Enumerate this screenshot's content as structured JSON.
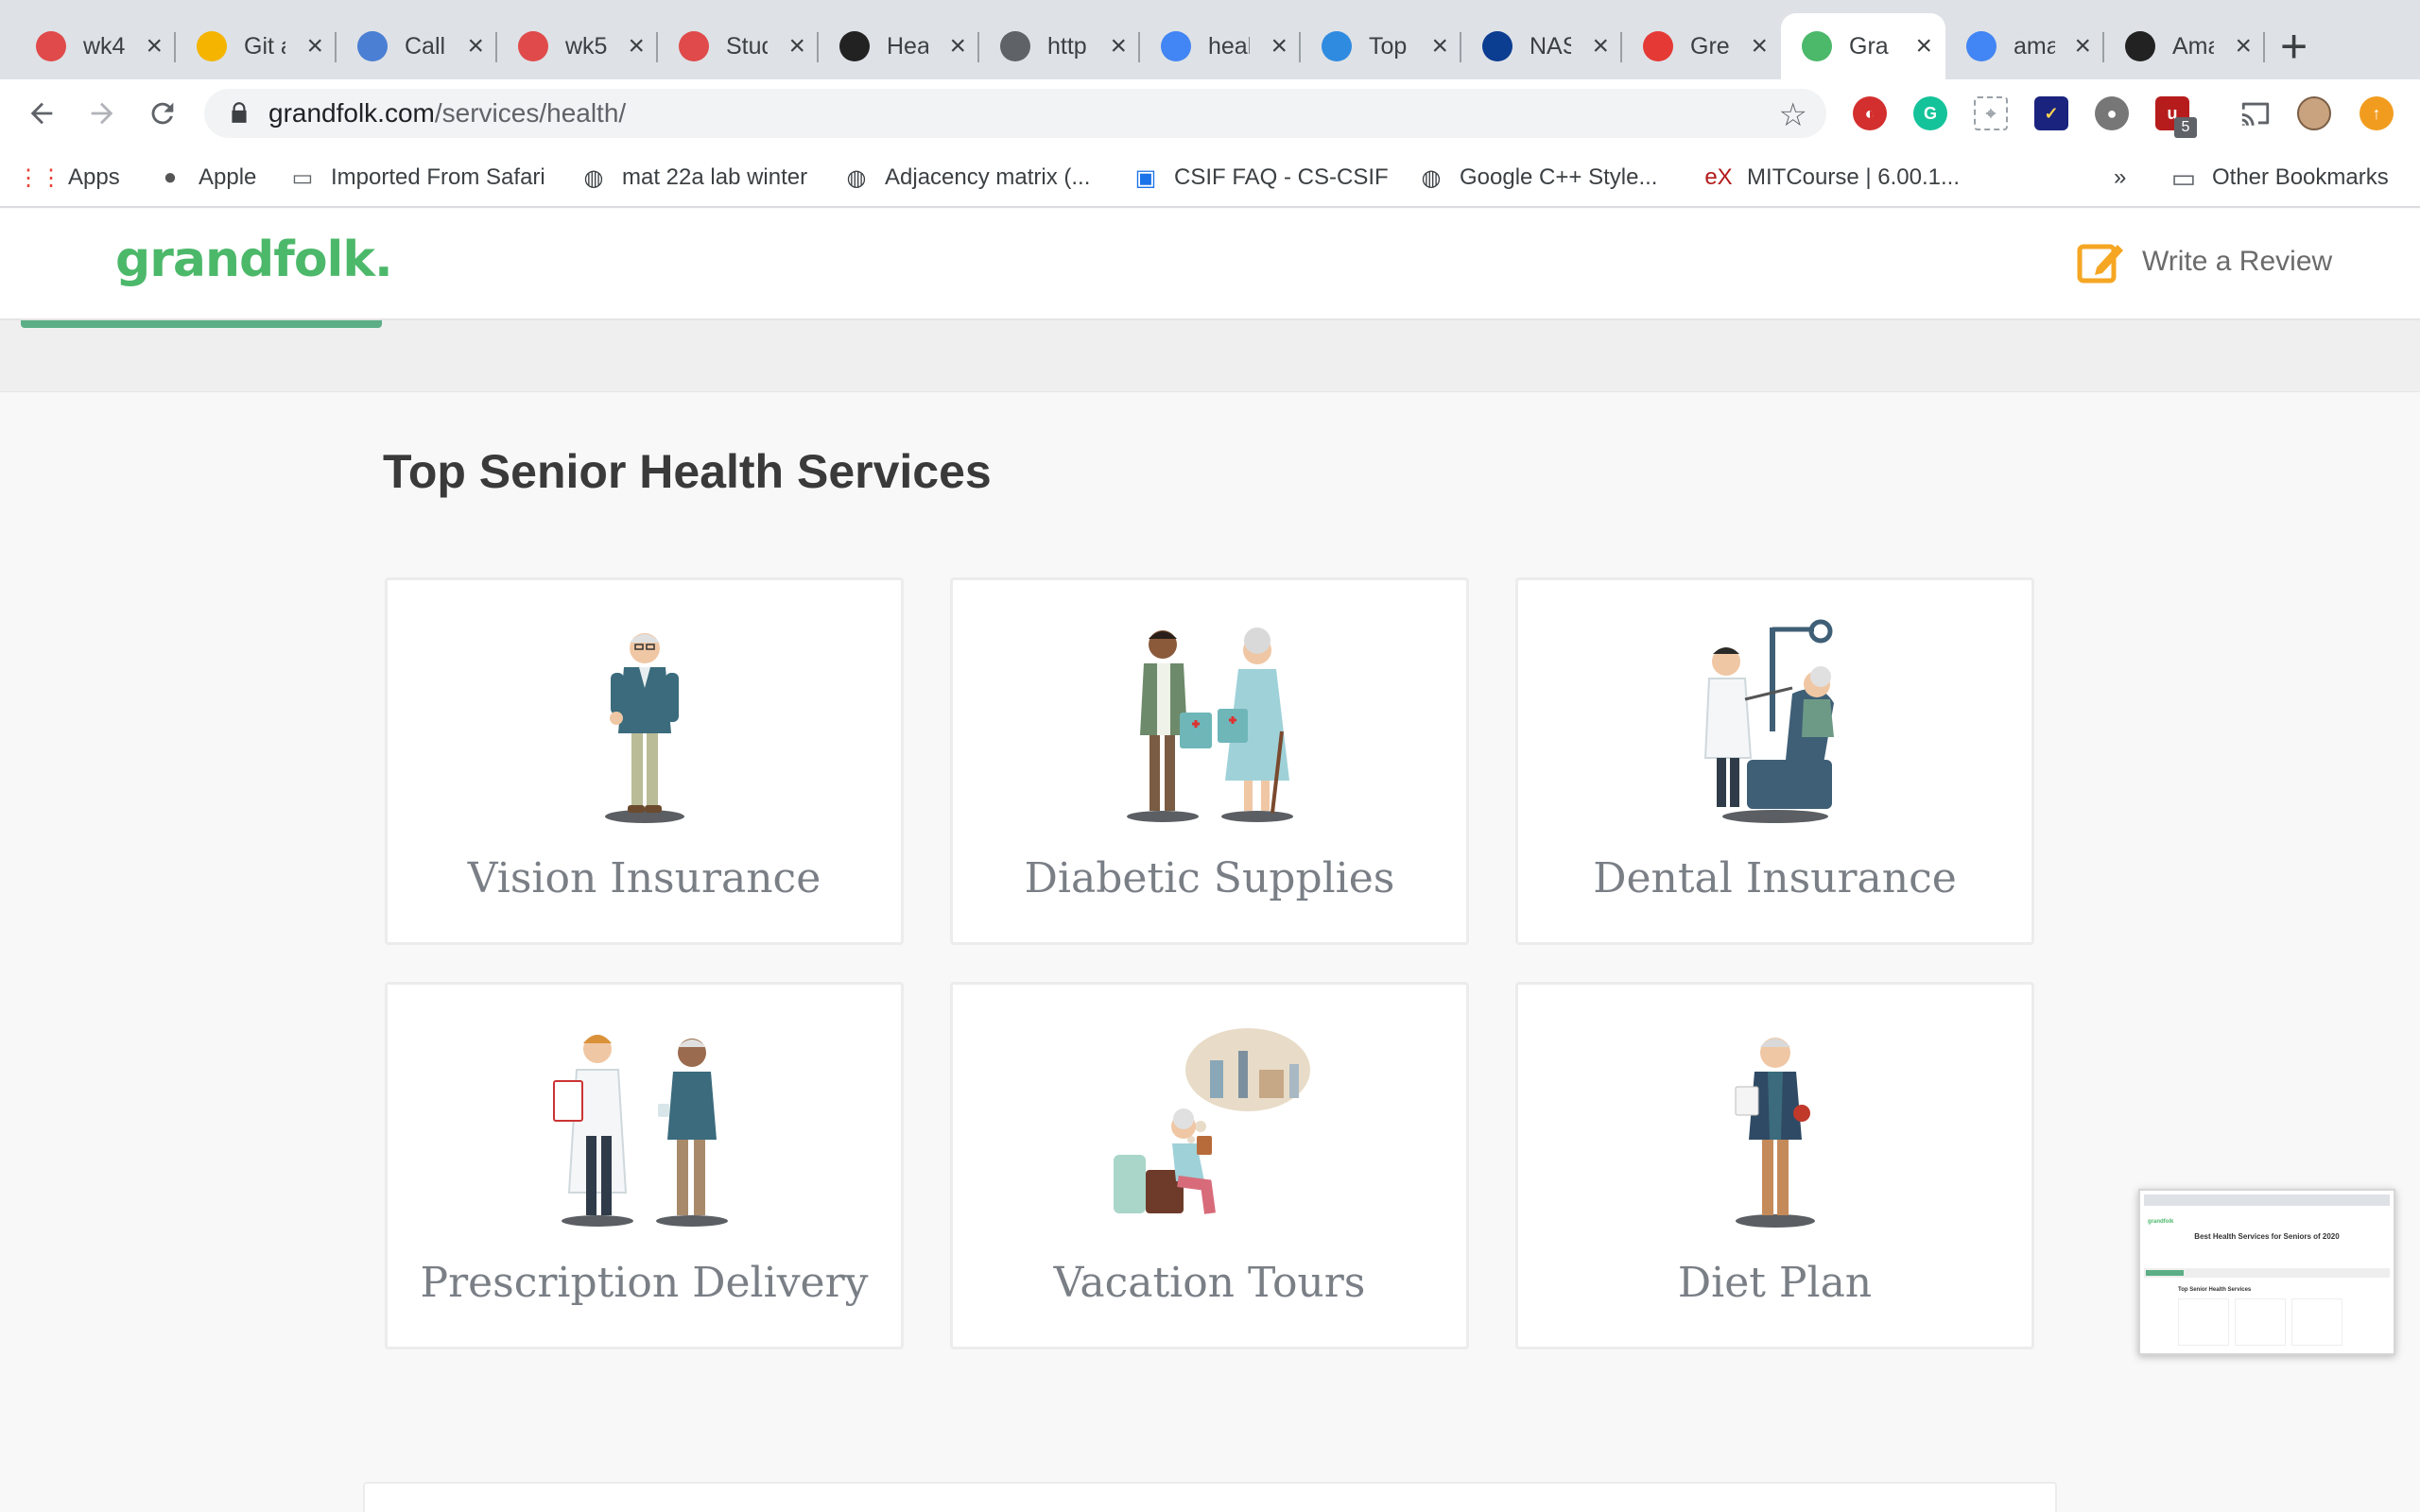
{
  "browser": {
    "tabs": [
      {
        "title": "wk4",
        "icon": "ucd-wheel-icon",
        "color": "#e04a4a"
      },
      {
        "title": "Git a",
        "icon": "slides-icon",
        "color": "#f4b400"
      },
      {
        "title": "Call",
        "icon": "app-icon",
        "color": "#4a7fd4"
      },
      {
        "title": "wk5",
        "icon": "ucd-wheel-icon",
        "color": "#e04a4a"
      },
      {
        "title": "Stud",
        "icon": "ucd-wheel-icon",
        "color": "#e04a4a"
      },
      {
        "title": "Hea",
        "icon": "qr-icon",
        "color": "#222222"
      },
      {
        "title": "http",
        "icon": "globe-icon",
        "color": "#5f6368"
      },
      {
        "title": "heal",
        "icon": "google-icon",
        "color": "#4285f4"
      },
      {
        "title": "Top",
        "icon": "chart-icon",
        "color": "#2f8be0"
      },
      {
        "title": "NAS",
        "icon": "nasa-icon",
        "color": "#0b3d91"
      },
      {
        "title": "Gre",
        "icon": "pin-icon",
        "color": "#e53935"
      },
      {
        "title": "Gra",
        "icon": "grandfolk-icon",
        "color": "#4cb86a"
      },
      {
        "title": "ama",
        "icon": "google-icon",
        "color": "#4285f4"
      },
      {
        "title": "Ama",
        "icon": "amazon-icon",
        "color": "#222222"
      }
    ],
    "active_tab": 11,
    "url_host": "grandfolk.com",
    "url_path": "/services/health/",
    "extension_badge": "5",
    "bookmarks": [
      {
        "label": "Apps",
        "icon": "apps-grid-icon"
      },
      {
        "label": "Apple",
        "icon": "apple-icon"
      },
      {
        "label": "Imported From Safari",
        "icon": "folder-icon"
      },
      {
        "label": "mat 22a lab winter",
        "icon": "globe-icon"
      },
      {
        "label": "Adjacency matrix (...",
        "icon": "globe-icon"
      },
      {
        "label": "CSIF FAQ - CS-CSIF",
        "icon": "page-icon"
      },
      {
        "label": "Google C++ Style...",
        "icon": "globe-icon"
      },
      {
        "label": "MITCourse | 6.00.1...",
        "icon": "edx-icon"
      }
    ],
    "more_bookmarks": "»",
    "other_bookmarks": "Other Bookmarks"
  },
  "header": {
    "logo_text": "grandfolk",
    "write_review": "Write a Review",
    "accent": "#4cb86a"
  },
  "main": {
    "section_title": "Top Senior Health Services",
    "services": [
      {
        "label": "Vision Insurance",
        "illustration": "elderly-man-thumbs-up"
      },
      {
        "label": "Diabetic Supplies",
        "illustration": "pharmacist-handing-bag-to-elderly-woman"
      },
      {
        "label": "Dental Insurance",
        "illustration": "dentist-with-patient-in-chair"
      },
      {
        "label": "Prescription Delivery",
        "illustration": "doctor-with-clipboard-and-elderly-man"
      },
      {
        "label": "Vacation Tours",
        "illustration": "elderly-woman-dreaming-of-travel"
      },
      {
        "label": "Diet Plan",
        "illustration": "elderly-man-reading-menu"
      }
    ]
  },
  "thumbnail": {
    "title": "Best Health Services for Seniors of 2020",
    "subtitle": "Top Senior Health Services"
  }
}
